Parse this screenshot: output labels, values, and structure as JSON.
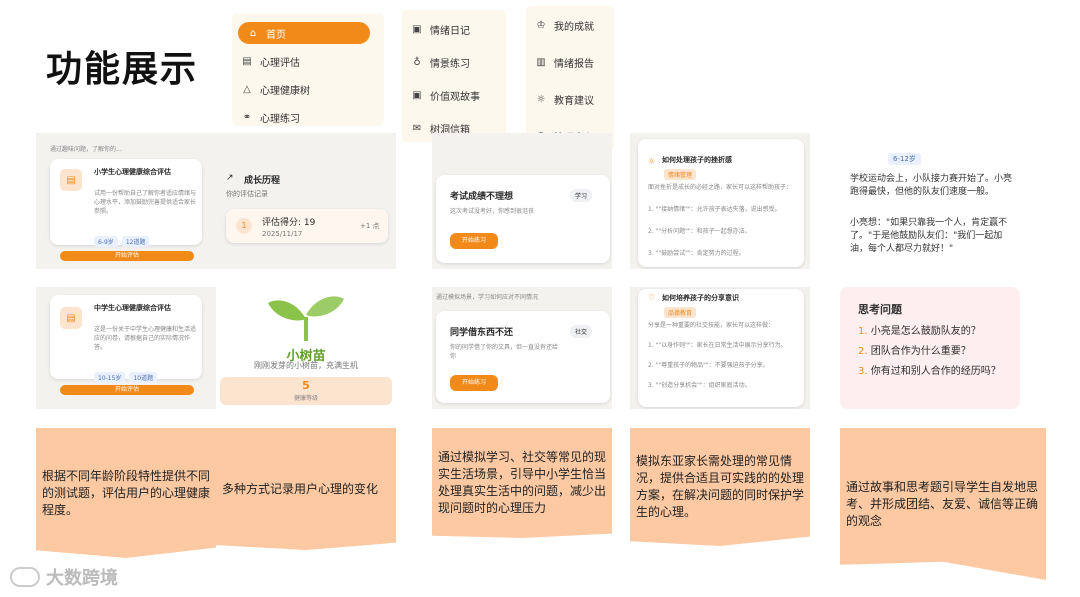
{
  "page_title": "功能展示",
  "menu1": [
    "首页",
    "心理评估",
    "心理健康树",
    "心理练习"
  ],
  "menu2": [
    "情绪日记",
    "情景练习",
    "价值观故事",
    "树洞信箱"
  ],
  "menu3": [
    "我的成就",
    "情绪报告",
    "教育建议",
    "管理中心"
  ],
  "card1a": {
    "top_text": "通过趣味问题，了解你的...",
    "title": "小学生心理健康综合评估",
    "body": "试用一份帮助自己了解你者适应情绪与心理水平，添加鼓励完善提供适合家长参照。",
    "chips": [
      "6-9岁",
      "12道题"
    ],
    "button": "开始评估"
  },
  "card1b": {
    "title": "中学生心理健康综合评估",
    "body": "这是一份关于中学生心理健康和生活适应的问卷，请根据自己的实际情况作答。",
    "chips": [
      "10-15岁",
      "10道题"
    ],
    "button": "开始评估"
  },
  "card2a": {
    "title": "成长历程",
    "subtitle": "你的评估记录",
    "record_index": "1",
    "record_title": "评估得分: 19",
    "record_date": "2025/11/17",
    "record_delta": "+1 点"
  },
  "card2b": {
    "tree_name": "小树苗",
    "tree_desc": "刚刚发芽的小树苗，充满生机",
    "level_value": "5",
    "level_label": "健康等级"
  },
  "card3a": {
    "title": "考试成绩不理想",
    "tag": "学习",
    "body": "这次考试没考好，你感到很沮丧",
    "button": "开始练习"
  },
  "card3b": {
    "top_text": "通过模拟场景，学习如何应对不同情况",
    "title": "同学借东西不还",
    "tag": "社交",
    "body": "你的同学借了你的文具，但一直没有还给你",
    "button": "开始练习"
  },
  "card4a": {
    "title": "如何处理孩子的挫折感",
    "tag": "情绪管理",
    "lines": [
      "面对挫折是成长的必经之路，家长可以这样帮助孩子：",
      "1. \"\"接纳情绪\"\"：允许孩子表达失落，说出感受。",
      "2. \"\"分析问题\"\"：和孩子一起想办法。",
      "3. \"\"鼓励尝试\"\"：肯定努力的过程。"
    ]
  },
  "card4b": {
    "title": "如何培养孩子的分享意识",
    "tag": "品德教育",
    "lines": [
      "分享是一种重要的社交技能，家长可以这样做：",
      "1. \"\"以身作则\"\"：家长在日常生活中展示分享行为。",
      "2. \"\"尊重孩子的物品\"\"：不要强迫孩子分享。",
      "3. \"\"创造分享机会\"\"：组织家庭活动。"
    ]
  },
  "card5a": {
    "chip": "6-12岁",
    "story": [
      "学校运动会上，小队接力赛开始了。小亮跑得最快，但他的队友们速度一般。",
      "小亮想：\"如果只靠我一个人，肯定赢不了。\"于是他鼓励队友们：\"我们一起加油，每个人都尽力就好！\""
    ]
  },
  "card5b": {
    "title": "思考问题",
    "questions": [
      "小亮是怎么鼓励队友的？",
      "团队合作为什么重要？",
      "你有过和别人合作的经历吗？"
    ]
  },
  "descriptions": [
    "根据不同年龄阶段特性提供不同的测试题，评估用户的心理健康程度。",
    "多种方式记录用户心理的变化",
    "通过模拟学习、社交等常见的现实生活场景，引导中小学生恰当处理真实生活中的问题，减少出现问题时的心理压力",
    "模拟东亚家长需处理的常见情况，提供合适且可实践的的处理方案，在解决问题的同时保护学生的心理。",
    "通过故事和思考题引导学生自发地思考、并形成团结、友爱、诚信等正确的观念"
  ],
  "watermark": "大数跨境",
  "colors": {
    "accent": "#f28a1a",
    "desc_bg": "#fcc9a3",
    "tree_green": "#8bc34a"
  }
}
